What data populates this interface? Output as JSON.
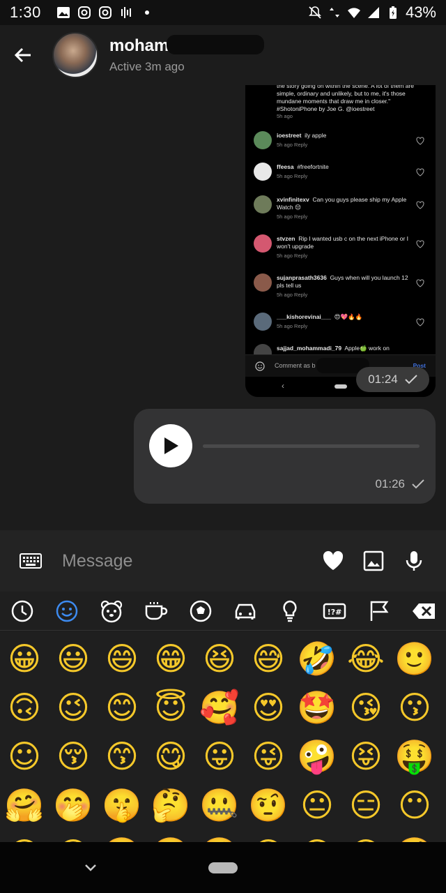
{
  "status_bar": {
    "time": "1:30",
    "battery": "43%"
  },
  "header": {
    "contact_name": "moham",
    "status": "Active 3m ago"
  },
  "shared_post": {
    "caption": "the story going on within the scene. A lot of them are simple, ordinary and unlikely, but to me, it's those mundane moments that draw me in closer.\" #ShotoniPhone by Joe G. @ioestreet",
    "caption_time": "5h ago",
    "comments": [
      {
        "user": "ioestreet",
        "text": "ily apple",
        "meta": "5h ago   Reply",
        "color": "#5b8a5a"
      },
      {
        "user": "ffeesa",
        "text": "#freefortnite",
        "meta": "5h ago   Reply",
        "color": "#e8e8e8"
      },
      {
        "user": "xvinfinitexv",
        "text": "Can you guys please ship my Apple Watch 😔",
        "meta": "5h ago   Reply",
        "color": "#6e7b5a"
      },
      {
        "user": "stvzen",
        "text": "Rip I wanted usb c on the next iPhone or I won't upgrade",
        "meta": "5h ago   Reply",
        "color": "#d45870"
      },
      {
        "user": "sujanprasath3636",
        "text": "Guys when will you launch 12 pls tell us",
        "meta": "5h ago   Reply",
        "color": "#8a5a4a"
      },
      {
        "user": "___kishorevinai___",
        "text": "😍💖🔥🔥",
        "meta": "5h ago   Reply",
        "color": "#5a6a7a"
      },
      {
        "user": "sajjad_mohammadi_79",
        "text": "Apple🍏 work on",
        "meta": "",
        "color": "#444"
      }
    ],
    "comment_placeholder": "Comment as b",
    "post_label": "Post",
    "nav_back": "‹",
    "sent_time": "01:24"
  },
  "voice_message": {
    "time": "01:26"
  },
  "composer": {
    "placeholder": "Message"
  },
  "emoji_categories": [
    "recent",
    "smileys",
    "animals",
    "food",
    "activities",
    "travel",
    "objects",
    "symbols",
    "flags",
    "backspace"
  ],
  "emoji_rows": [
    [
      "😀",
      "😃",
      "😄",
      "😁",
      "😆",
      "😅",
      "🤣",
      "😂",
      "🙂"
    ],
    [
      "🙃",
      "😉",
      "😊",
      "😇",
      "🥰",
      "😍",
      "🤩",
      "😘",
      "😗"
    ],
    [
      "☺",
      "😚",
      "😙",
      "😋",
      "😛",
      "😜",
      "🤪",
      "😝",
      "🤑"
    ],
    [
      "🤗",
      "🤭",
      "🤫",
      "🤔",
      "🤐",
      "🤨",
      "😐",
      "😑",
      "😶"
    ],
    [
      "😏",
      "😒",
      "🙄",
      "😬",
      "🤥",
      "😌",
      "😔",
      "😪",
      "🤤"
    ]
  ],
  "colors": {
    "background": "#1c1c1c",
    "bubble": "#333334",
    "accent": "#3f6fd9"
  }
}
